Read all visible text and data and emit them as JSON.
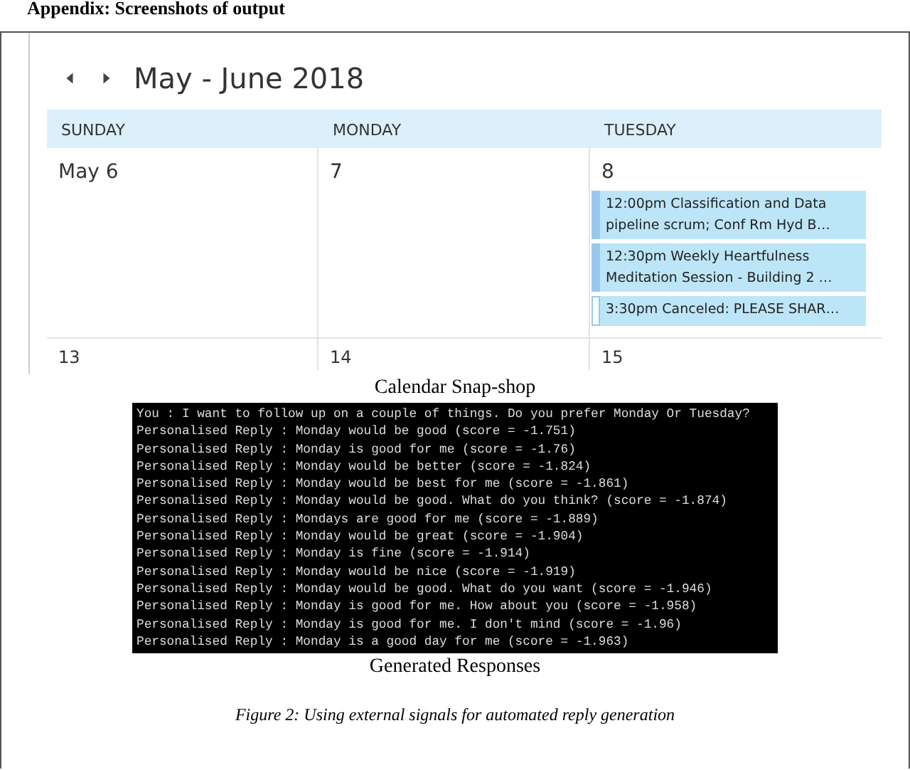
{
  "heading": "Appendix: Screenshots of output",
  "calendar": {
    "title": "May - June 2018",
    "days": [
      "SUNDAY",
      "MONDAY",
      "TUESDAY"
    ],
    "weeks": [
      {
        "cells": [
          {
            "date": "May 6"
          },
          {
            "date": "7"
          },
          {
            "date": "8",
            "events": [
              {
                "text": "12:00pm Classification and Data pipeline scrum; Conf Rm Hyd B…",
                "canceled": false
              },
              {
                "text": "12:30pm Weekly Heartfulness Meditation Session - Building 2 …",
                "canceled": false
              },
              {
                "text": "3:30pm Canceled: PLEASE SHAR…",
                "canceled": true
              }
            ]
          }
        ]
      },
      {
        "cells": [
          {
            "date": "13"
          },
          {
            "date": "14"
          },
          {
            "date": "15"
          }
        ]
      }
    ]
  },
  "calendar_caption": "Calendar Snap-shop",
  "terminal": {
    "lines": [
      "You : I want to follow up on a couple of things. Do you prefer Monday Or Tuesday?",
      "Personalised Reply : Monday would be good (score = -1.751)",
      "Personalised Reply : Monday is good for me (score = -1.76)",
      "Personalised Reply : Monday would be better (score = -1.824)",
      "Personalised Reply : Monday would be best for me (score = -1.861)",
      "Personalised Reply : Monday would be good. What do you think? (score = -1.874)",
      "Personalised Reply : Mondays are good for me (score = -1.889)",
      "Personalised Reply : Monday would be great (score = -1.904)",
      "Personalised Reply : Monday is fine (score = -1.914)",
      "Personalised Reply : Monday would be nice (score = -1.919)",
      "Personalised Reply : Monday would be good. What do you want (score = -1.946)",
      "Personalised Reply : Monday is good for me. How about you (score = -1.958)",
      "Personalised Reply : Monday is good for me. I don't mind (score = -1.96)",
      "Personalised Reply : Monday is a good day for me (score = -1.963)"
    ]
  },
  "terminal_caption": "Generated Responses",
  "figure_caption": "Figure 2: Using external signals for automated reply generation"
}
